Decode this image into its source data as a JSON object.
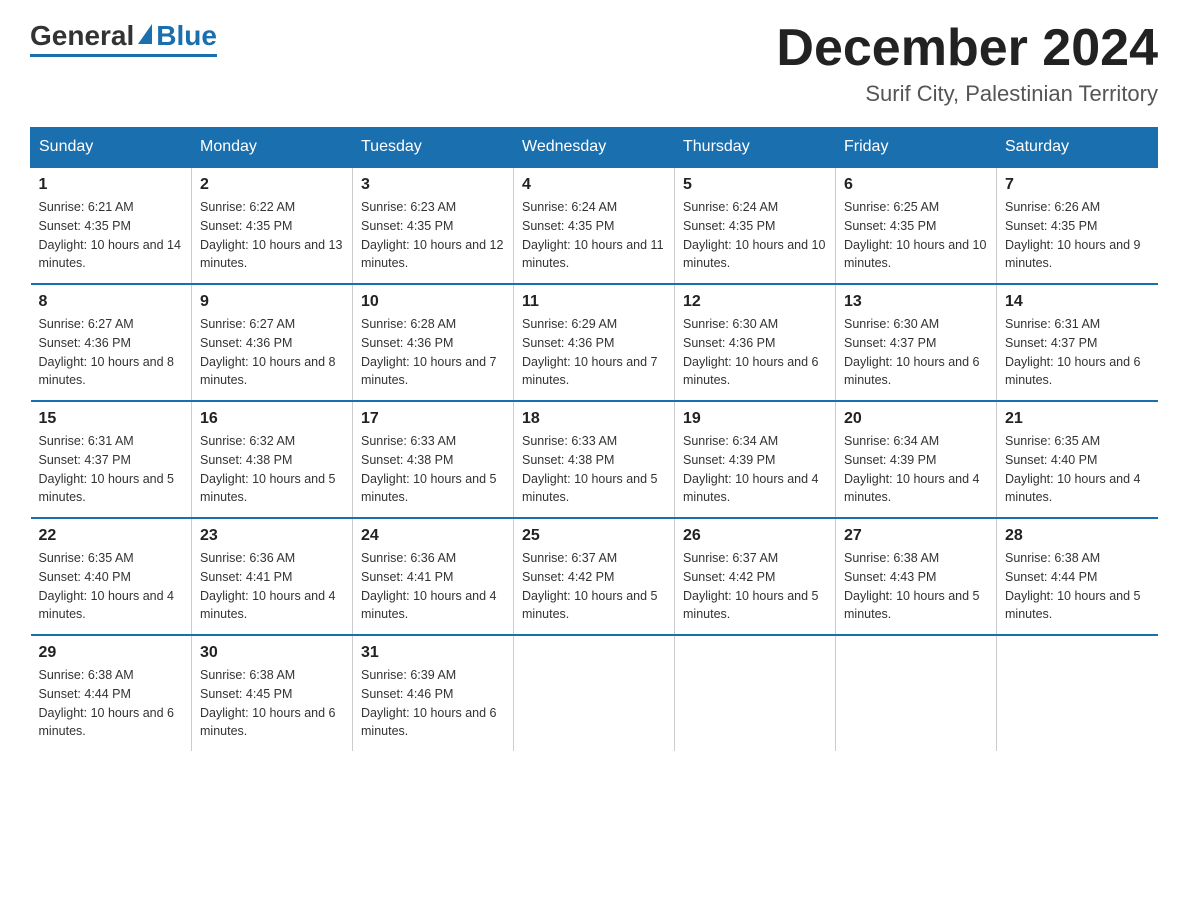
{
  "logo": {
    "general": "General",
    "blue": "Blue"
  },
  "header": {
    "month": "December 2024",
    "location": "Surif City, Palestinian Territory"
  },
  "days": [
    "Sunday",
    "Monday",
    "Tuesday",
    "Wednesday",
    "Thursday",
    "Friday",
    "Saturday"
  ],
  "weeks": [
    [
      {
        "day": "1",
        "sunrise": "6:21 AM",
        "sunset": "4:35 PM",
        "daylight": "10 hours and 14 minutes."
      },
      {
        "day": "2",
        "sunrise": "6:22 AM",
        "sunset": "4:35 PM",
        "daylight": "10 hours and 13 minutes."
      },
      {
        "day": "3",
        "sunrise": "6:23 AM",
        "sunset": "4:35 PM",
        "daylight": "10 hours and 12 minutes."
      },
      {
        "day": "4",
        "sunrise": "6:24 AM",
        "sunset": "4:35 PM",
        "daylight": "10 hours and 11 minutes."
      },
      {
        "day": "5",
        "sunrise": "6:24 AM",
        "sunset": "4:35 PM",
        "daylight": "10 hours and 10 minutes."
      },
      {
        "day": "6",
        "sunrise": "6:25 AM",
        "sunset": "4:35 PM",
        "daylight": "10 hours and 10 minutes."
      },
      {
        "day": "7",
        "sunrise": "6:26 AM",
        "sunset": "4:35 PM",
        "daylight": "10 hours and 9 minutes."
      }
    ],
    [
      {
        "day": "8",
        "sunrise": "6:27 AM",
        "sunset": "4:36 PM",
        "daylight": "10 hours and 8 minutes."
      },
      {
        "day": "9",
        "sunrise": "6:27 AM",
        "sunset": "4:36 PM",
        "daylight": "10 hours and 8 minutes."
      },
      {
        "day": "10",
        "sunrise": "6:28 AM",
        "sunset": "4:36 PM",
        "daylight": "10 hours and 7 minutes."
      },
      {
        "day": "11",
        "sunrise": "6:29 AM",
        "sunset": "4:36 PM",
        "daylight": "10 hours and 7 minutes."
      },
      {
        "day": "12",
        "sunrise": "6:30 AM",
        "sunset": "4:36 PM",
        "daylight": "10 hours and 6 minutes."
      },
      {
        "day": "13",
        "sunrise": "6:30 AM",
        "sunset": "4:37 PM",
        "daylight": "10 hours and 6 minutes."
      },
      {
        "day": "14",
        "sunrise": "6:31 AM",
        "sunset": "4:37 PM",
        "daylight": "10 hours and 6 minutes."
      }
    ],
    [
      {
        "day": "15",
        "sunrise": "6:31 AM",
        "sunset": "4:37 PM",
        "daylight": "10 hours and 5 minutes."
      },
      {
        "day": "16",
        "sunrise": "6:32 AM",
        "sunset": "4:38 PM",
        "daylight": "10 hours and 5 minutes."
      },
      {
        "day": "17",
        "sunrise": "6:33 AM",
        "sunset": "4:38 PM",
        "daylight": "10 hours and 5 minutes."
      },
      {
        "day": "18",
        "sunrise": "6:33 AM",
        "sunset": "4:38 PM",
        "daylight": "10 hours and 5 minutes."
      },
      {
        "day": "19",
        "sunrise": "6:34 AM",
        "sunset": "4:39 PM",
        "daylight": "10 hours and 4 minutes."
      },
      {
        "day": "20",
        "sunrise": "6:34 AM",
        "sunset": "4:39 PM",
        "daylight": "10 hours and 4 minutes."
      },
      {
        "day": "21",
        "sunrise": "6:35 AM",
        "sunset": "4:40 PM",
        "daylight": "10 hours and 4 minutes."
      }
    ],
    [
      {
        "day": "22",
        "sunrise": "6:35 AM",
        "sunset": "4:40 PM",
        "daylight": "10 hours and 4 minutes."
      },
      {
        "day": "23",
        "sunrise": "6:36 AM",
        "sunset": "4:41 PM",
        "daylight": "10 hours and 4 minutes."
      },
      {
        "day": "24",
        "sunrise": "6:36 AM",
        "sunset": "4:41 PM",
        "daylight": "10 hours and 4 minutes."
      },
      {
        "day": "25",
        "sunrise": "6:37 AM",
        "sunset": "4:42 PM",
        "daylight": "10 hours and 5 minutes."
      },
      {
        "day": "26",
        "sunrise": "6:37 AM",
        "sunset": "4:42 PM",
        "daylight": "10 hours and 5 minutes."
      },
      {
        "day": "27",
        "sunrise": "6:38 AM",
        "sunset": "4:43 PM",
        "daylight": "10 hours and 5 minutes."
      },
      {
        "day": "28",
        "sunrise": "6:38 AM",
        "sunset": "4:44 PM",
        "daylight": "10 hours and 5 minutes."
      }
    ],
    [
      {
        "day": "29",
        "sunrise": "6:38 AM",
        "sunset": "4:44 PM",
        "daylight": "10 hours and 6 minutes."
      },
      {
        "day": "30",
        "sunrise": "6:38 AM",
        "sunset": "4:45 PM",
        "daylight": "10 hours and 6 minutes."
      },
      {
        "day": "31",
        "sunrise": "6:39 AM",
        "sunset": "4:46 PM",
        "daylight": "10 hours and 6 minutes."
      },
      null,
      null,
      null,
      null
    ]
  ]
}
